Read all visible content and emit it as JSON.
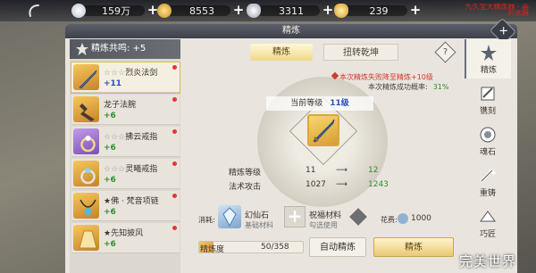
{
  "topbar": {
    "currencies": [
      {
        "value": "159万",
        "icon": "pearl-icon",
        "color": "#d8dde6"
      },
      {
        "value": "8553",
        "icon": "gold-coin-icon",
        "color": "#e8b84a"
      },
      {
        "value": "3311",
        "icon": "silver-ingot-icon",
        "color": "#c9ccd2"
      },
      {
        "value": "239",
        "icon": "gold-ingot-icon",
        "color": "#e8b84a"
      }
    ],
    "notice": "九久宝大精炼器 · 晶石炼器"
  },
  "panel": {
    "title": "精炼",
    "resonance": "精炼共鸣: +5",
    "tabs": {
      "refine": "精炼",
      "reverse": "扭转乾坤"
    },
    "help": "?",
    "close": "+"
  },
  "items": [
    {
      "stars": "☆☆☆",
      "name": "烈炎法剑",
      "level": "+11",
      "level_color": "blue",
      "selected": true,
      "thumb": "gold"
    },
    {
      "stars": "",
      "name": "龙子法腕",
      "level": "+6",
      "level_color": "green",
      "selected": false,
      "thumb": "gold"
    },
    {
      "stars": "☆☆☆",
      "name": "拂云戒指",
      "level": "+6",
      "level_color": "green",
      "selected": false,
      "thumb": "purple"
    },
    {
      "stars": "☆☆☆",
      "name": "灵曦戒指",
      "level": "+6",
      "level_color": "green",
      "selected": false,
      "thumb": "gold"
    },
    {
      "stars": "★",
      "name": "佛 · 梵音项链",
      "level": "+6",
      "level_color": "green",
      "selected": false,
      "thumb": "gold"
    },
    {
      "stars": "★",
      "name": "先知披风",
      "level": "+6",
      "level_color": "green",
      "selected": false,
      "thumb": "gold"
    }
  ],
  "refine": {
    "notice": "本次精炼失败降至精炼+10级",
    "success_label": "本次精炼成功概率:",
    "success_rate": "31%",
    "current_level_label": "当前等级",
    "current_level": "11级",
    "stats": [
      {
        "label": "精炼等级",
        "current": "11",
        "arrow": "⟶",
        "next": "12"
      },
      {
        "label": "法术攻击",
        "current": "1027",
        "arrow": "⟶",
        "next": "1243"
      }
    ]
  },
  "materials": {
    "consume_label": "消耗:",
    "material_name": "幻仙石",
    "material_sub": "基础材料",
    "bless_name": "祝福材料",
    "bless_sub": "勾选使用",
    "cost_label": "花费:",
    "cost_value": "1000"
  },
  "progress": {
    "label": "精炼度",
    "value": "50/358",
    "fraction": 0.14
  },
  "buttons": {
    "auto": "自动精炼",
    "refine": "精炼"
  },
  "right_nav": [
    {
      "label": "精炼",
      "icon": "refine-icon",
      "active": true
    },
    {
      "label": "镌刻",
      "icon": "engrave-icon",
      "active": false
    },
    {
      "label": "魂石",
      "icon": "soul-stone-icon",
      "active": false
    },
    {
      "label": "重铸",
      "icon": "recast-icon",
      "active": false
    },
    {
      "label": "巧匠",
      "icon": "craftsman-icon",
      "active": false
    }
  ],
  "logo": "完美世界"
}
